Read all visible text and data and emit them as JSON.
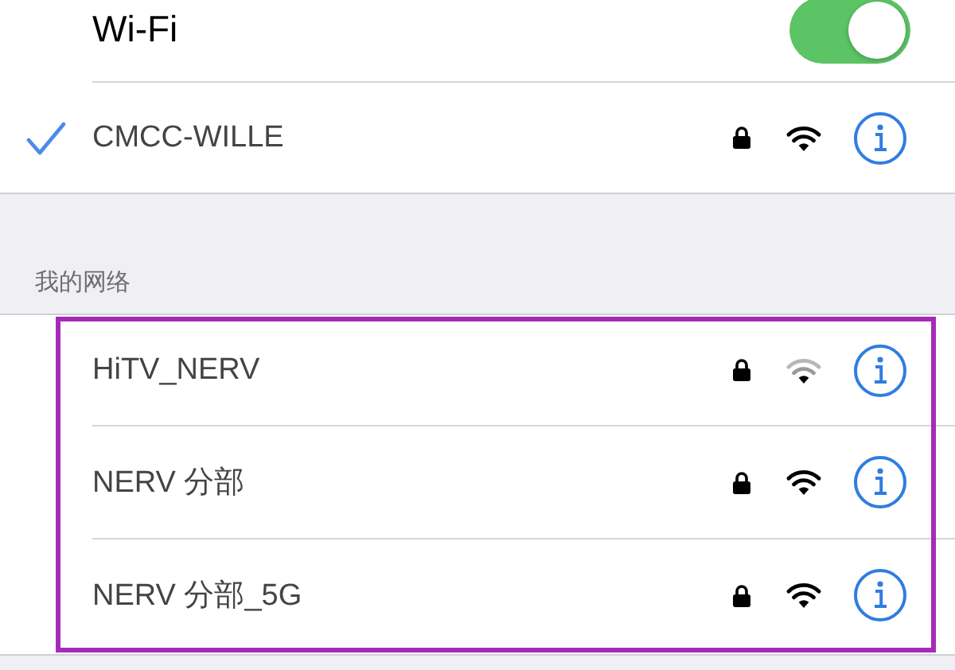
{
  "wifi": {
    "label": "Wi-Fi",
    "on": true
  },
  "current_network": {
    "name": "CMCC-WILLE",
    "connected": true,
    "locked": true,
    "weak_signal": false
  },
  "my_networks": {
    "header": "我的网络",
    "networks": [
      {
        "name": "HiTV_NERV",
        "locked": true,
        "weak_signal": true
      },
      {
        "name": "NERV 分部",
        "locked": true,
        "weak_signal": false
      },
      {
        "name": "NERV 分部_5G",
        "locked": true,
        "weak_signal": false
      }
    ]
  }
}
